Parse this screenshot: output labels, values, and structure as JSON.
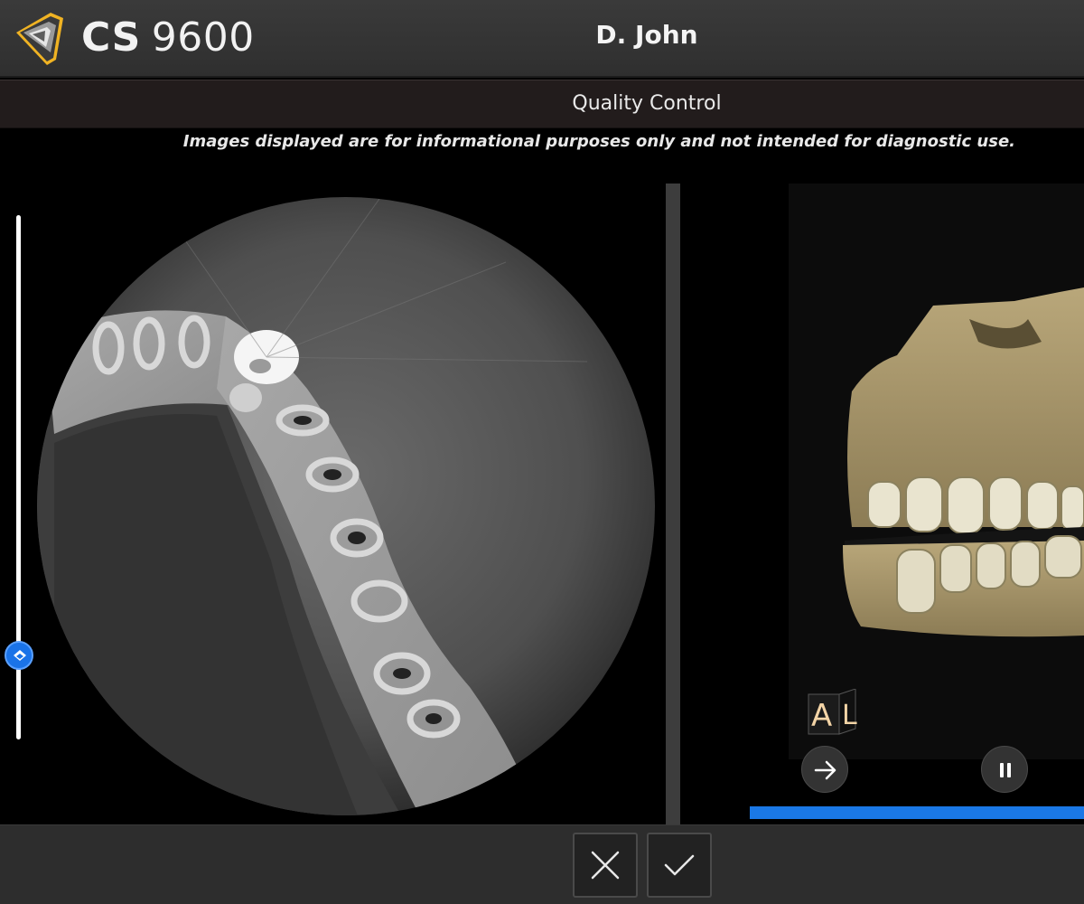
{
  "header": {
    "brand_bold": "CS",
    "brand_model": "9600",
    "patient_name": "D. John"
  },
  "subbar": {
    "title": "Quality Control"
  },
  "disclaimer": "Images displayed are for informational purposes only and not intended for diagnostic use.",
  "viewer": {
    "slice_slider_position": 0.84,
    "orientation_front": "A",
    "orientation_side": "L",
    "playback_progress": 1.0
  },
  "icons": {
    "logo": "shield-logo-icon",
    "slider": "slider-handle-icon",
    "next": "arrow-right-icon",
    "pause": "pause-icon",
    "reject": "close-icon",
    "accept": "check-icon"
  },
  "colors": {
    "accent": "#1a78e6",
    "logo_gold": "#f0b323",
    "header_bg": "#333333",
    "orientation_label": "#f3d4a6"
  }
}
